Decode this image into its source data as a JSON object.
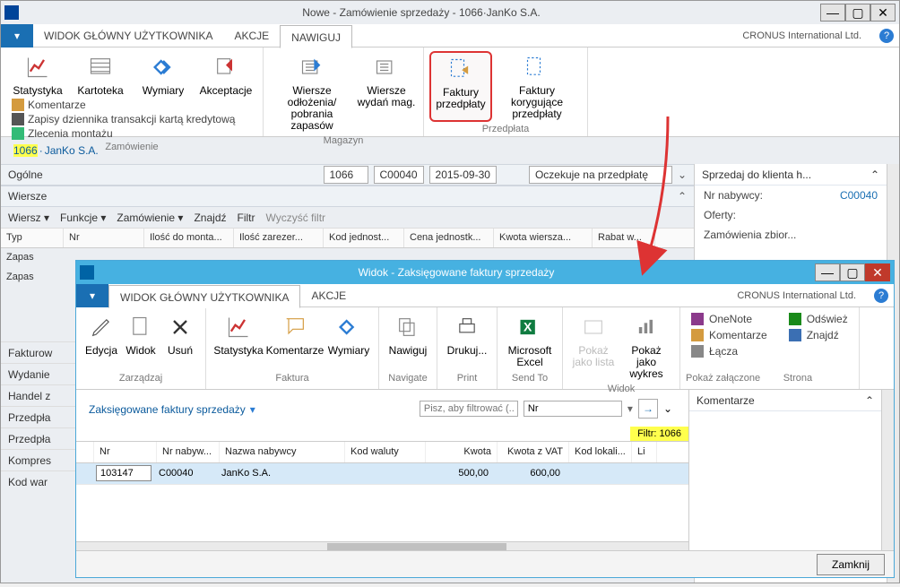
{
  "win1": {
    "title": "Nowe - Zamówienie sprzedaży - 1066·JanKo S.A.",
    "tabs": {
      "main": "WIDOK GŁÓWNY UŻYTKOWNIKA",
      "actions": "AKCJE",
      "nav": "NAWIGUJ"
    },
    "company": "CRONUS International Ltd.",
    "ribbon": {
      "order_items": {
        "stat": "Statystyka",
        "card": "Kartoteka",
        "dim": "Wymiary",
        "acc": "Akceptacje"
      },
      "list": {
        "com": "Komentarze",
        "ccard": "Zapisy dziennika transakcji kartą kredytową",
        "assm": "Zlecenia montażu"
      },
      "order_grp": "Zamówienie",
      "mag": {
        "putaway": "Wiersze odłożenia/ pobrania zapasów",
        "issue": "Wiersze wydań mag."
      },
      "mag_grp": "Magazyn",
      "prepay": {
        "inv": "Faktury przedpłaty",
        "cred": "Faktury korygujące przedpłaty"
      },
      "prepay_grp": "Przedpłata"
    },
    "doc": {
      "no": "1066",
      "sep": "·",
      "name": "JanKo S.A."
    },
    "general": {
      "label": "Ogólne",
      "no": "1066",
      "cust": "C00040",
      "date": "2015-09-30",
      "status": "Oczekuje na przedpłatę"
    },
    "lines": {
      "label": "Wiersze",
      "tools": {
        "line": "Wiersz ▾",
        "fn": "Funkcje ▾",
        "order": "Zamówienie ▾",
        "find": "Znajdź",
        "filter": "Filtr",
        "clear": "Wyczyść filtr"
      },
      "cols": {
        "type": "Typ",
        "no": "Nr",
        "qtyasm": "Ilość do monta...",
        "qtyres": "Ilość zarezer...",
        "uom": "Kod jednost...",
        "price": "Cena jednostk...",
        "amt": "Kwota wiersza...",
        "disc": "Rabat w..."
      },
      "rows": {
        "r1": "Zapas",
        "r2": "Zapas"
      }
    },
    "ft": {
      "fakt": "Fakturow",
      "wyd": "Wydanie",
      "handel": "Handel z",
      "przedpla": "Przedpła",
      "przedpla2": "Przedpła",
      "komp": "Kompres",
      "kodwar": "Kod war"
    },
    "side": {
      "header": "Sprzedaj do klienta h...",
      "nr": "Nr nabywcy:",
      "nr_v": "C00040",
      "of": "Oferty:",
      "zb": "Zamówienia zbior..."
    }
  },
  "win2": {
    "title": "Widok - Zaksięgowane faktury sprzedaży",
    "tabs": {
      "main": "WIDOK GŁÓWNY UŻYTKOWNIKA",
      "actions": "AKCJE"
    },
    "company": "CRONUS International Ltd.",
    "ribbon": {
      "manage": {
        "edit": "Edycja",
        "view": "Widok",
        "del": "Usuń",
        "grp": "Zarządzaj"
      },
      "invoice": {
        "stat": "Statystyka",
        "com": "Komentarze",
        "dim": "Wymiary",
        "grp": "Faktura"
      },
      "nav": {
        "nav": "Nawiguj",
        "grp": "Navigate"
      },
      "print": {
        "print": "Drukuj...",
        "grp": "Print"
      },
      "send": {
        "excel": "Microsoft Excel",
        "grp": "Send To"
      },
      "viewg": {
        "list": "Pokaż jako lista",
        "chart": "Pokaż jako wykres",
        "grp": "Widok"
      },
      "side1": {
        "on": "OneNote",
        "km": "Komentarze",
        "lc": "Łącza",
        "grp": "Pokaż załączone"
      },
      "side2": {
        "od": "Odśwież",
        "zn": "Znajdź",
        "grp": "Strona"
      }
    },
    "heading": "Zaksięgowane faktury sprzedaży",
    "filter": {
      "ph": "Pisz, aby filtrować (...",
      "field": "Nr"
    },
    "filter_tag": "Filtr: 1066",
    "grid": {
      "cols": {
        "no": "Nr",
        "cust": "Nr nabyw...",
        "name": "Nazwa nabywcy",
        "cur": "Kod waluty",
        "amt": "Kwota",
        "amtvat": "Kwota z VAT",
        "loc": "Kod lokali...",
        "li": "Li"
      },
      "row": {
        "no": "103147",
        "cust": "C00040",
        "name": "JanKo S.A.",
        "cur": "",
        "amt": "500,00",
        "amtvat": "600,00",
        "loc": "",
        "li": ""
      }
    },
    "side": {
      "header": "Komentarze"
    },
    "close": "Zamknij"
  }
}
